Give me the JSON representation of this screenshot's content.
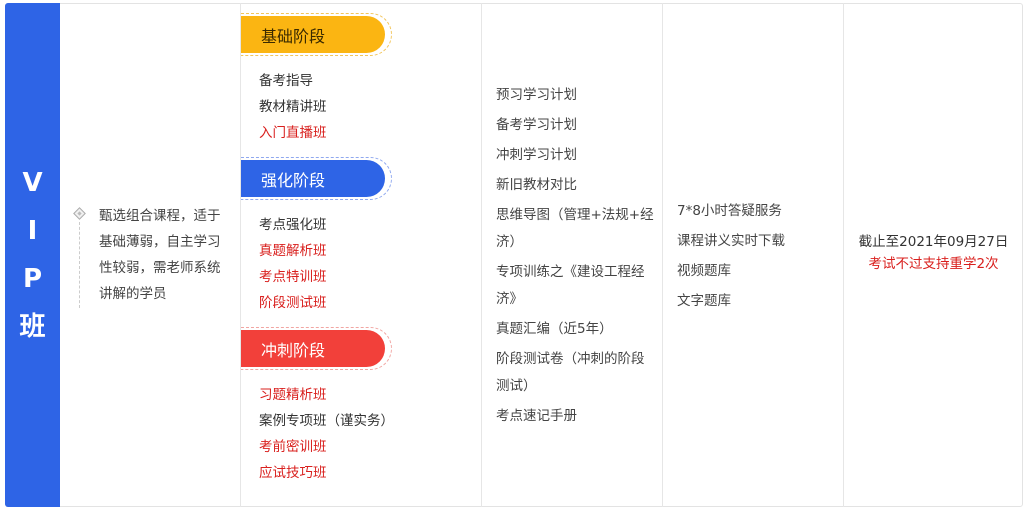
{
  "vip_label": [
    "V",
    "I",
    "P",
    "班"
  ],
  "description": "甄选组合课程，适于基础薄弱，自主学习性较弱，需老师系统讲解的学员",
  "stages": [
    {
      "title": "基础阶段",
      "color": "#fbb512",
      "courses": [
        {
          "label": "备考指导",
          "highlight": false
        },
        {
          "label": "教材精讲班",
          "highlight": false
        },
        {
          "label": "入门直播班",
          "highlight": true
        }
      ]
    },
    {
      "title": "强化阶段",
      "color": "#2e64e6",
      "courses": [
        {
          "label": "考点强化班",
          "highlight": false
        },
        {
          "label": "真题解析班",
          "highlight": true
        },
        {
          "label": "考点特训班",
          "highlight": true
        },
        {
          "label": "阶段测试班",
          "highlight": true
        }
      ]
    },
    {
      "title": "冲刺阶段",
      "color": "#f2403a",
      "courses": [
        {
          "label": "习题精析班",
          "highlight": true
        },
        {
          "label": "案例专项班（谨实务）",
          "highlight": false
        },
        {
          "label": "考前密训班",
          "highlight": true
        },
        {
          "label": "应试技巧班",
          "highlight": true
        }
      ]
    }
  ],
  "materials": [
    "预习学习计划",
    "备考学习计划",
    "冲刺学习计划",
    "新旧教材对比",
    "思维导图（管理+法规+经济）",
    "专项训练之《建设工程经济》",
    "真题汇编（近5年）",
    "阶段测试卷（冲刺的阶段测试）",
    "考点速记手册"
  ],
  "services": [
    "7*8小时答疑服务",
    "课程讲义实时下载",
    "视频题库",
    "文字题库"
  ],
  "exam": {
    "deadline": "截止至2021年09月27日",
    "note": "考试不过支持重学2次"
  }
}
